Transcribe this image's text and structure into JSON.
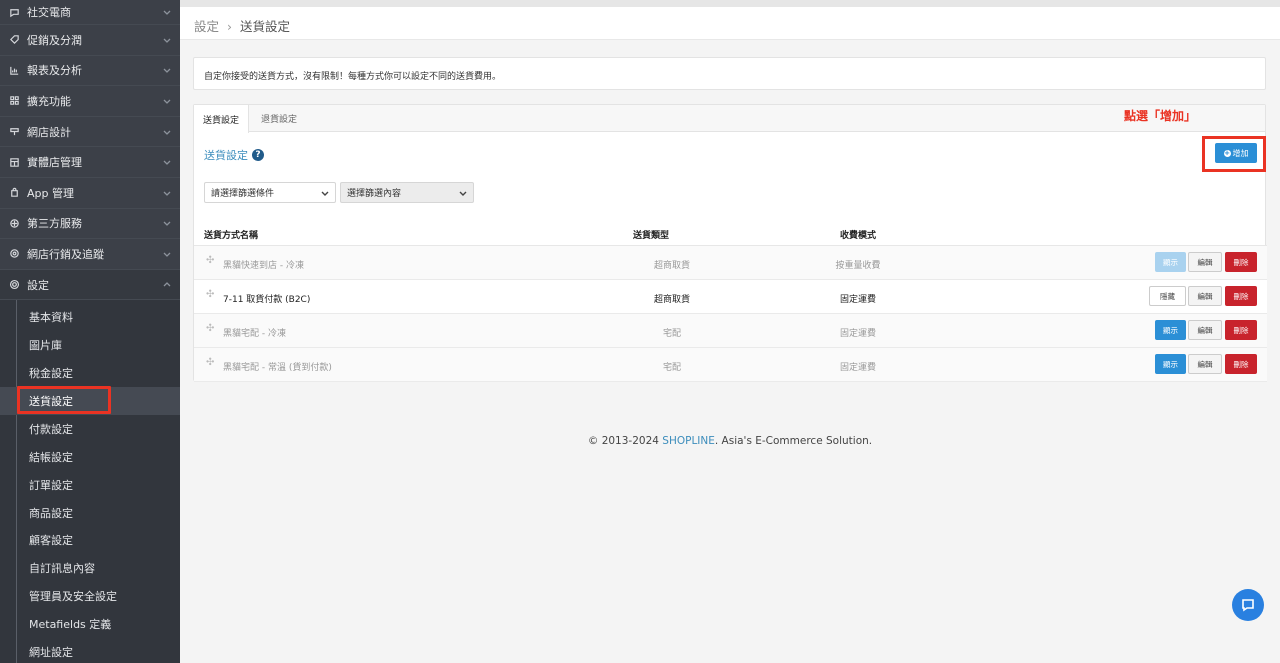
{
  "sidebar": {
    "items": [
      {
        "label": "社交電商",
        "icon": "chat-icon"
      },
      {
        "label": "促銷及分潤",
        "icon": "tag-icon"
      },
      {
        "label": "報表及分析",
        "icon": "chart-icon"
      },
      {
        "label": "擴充功能",
        "icon": "grid-icon"
      },
      {
        "label": "網店設計",
        "icon": "brush-icon"
      },
      {
        "label": "實體店管理",
        "icon": "store-icon"
      },
      {
        "label": "App 管理",
        "icon": "bag-icon"
      },
      {
        "label": "第三方服務",
        "icon": "puzzle-icon"
      },
      {
        "label": "網店行銷及追蹤",
        "icon": "target-icon"
      },
      {
        "label": "設定",
        "icon": "gear-icon"
      }
    ],
    "settings_sub": [
      "基本資料",
      "圖片庫",
      "稅金設定",
      "送貨設定",
      "付款設定",
      "結帳設定",
      "訂單設定",
      "商品設定",
      "顧客設定",
      "自訂訊息內容",
      "管理員及安全設定",
      "Metafields 定義",
      "網址設定"
    ]
  },
  "breadcrumb": {
    "parent": "設定",
    "separator": "›",
    "current": "送貨設定"
  },
  "notice": "自定你接受的送貨方式，沒有限制！每種方式你可以設定不同的送貨費用。",
  "tabs": [
    "送貨設定",
    "退貨設定"
  ],
  "annotation": "點選「增加」",
  "section_title": "送貨設定",
  "add_button": "增加",
  "filters": {
    "condition": "請選擇篩選條件",
    "content": "選擇篩選內容"
  },
  "table": {
    "headers": [
      "送貨方式名稱",
      "送貨類型",
      "收費模式"
    ],
    "rows": [
      {
        "name": "黑貓快速到店 - 冷凍",
        "type": "超商取貨",
        "fee": "按重量收費",
        "toggle": "顯示"
      },
      {
        "name": "7-11 取貨付款 (B2C)",
        "type": "超商取貨",
        "fee": "固定運費",
        "toggle": "隱藏"
      },
      {
        "name": "黑貓宅配 - 冷凍",
        "type": "宅配",
        "fee": "固定運費",
        "toggle": "顯示"
      },
      {
        "name": "黑貓宅配 - 常溫 (貨到付款)",
        "type": "宅配",
        "fee": "固定運費",
        "toggle": "顯示"
      }
    ],
    "edit_label": "編輯",
    "delete_label": "刪除"
  },
  "footer": {
    "prefix": "© 2013-2024 ",
    "brand": "SHOPLINE",
    "suffix": ". Asia's E-Commerce Solution."
  },
  "colors": {
    "accent": "#2b8fd6",
    "danger": "#c8232c",
    "highlight": "#ea3323",
    "sidebar": "#3c4048"
  }
}
